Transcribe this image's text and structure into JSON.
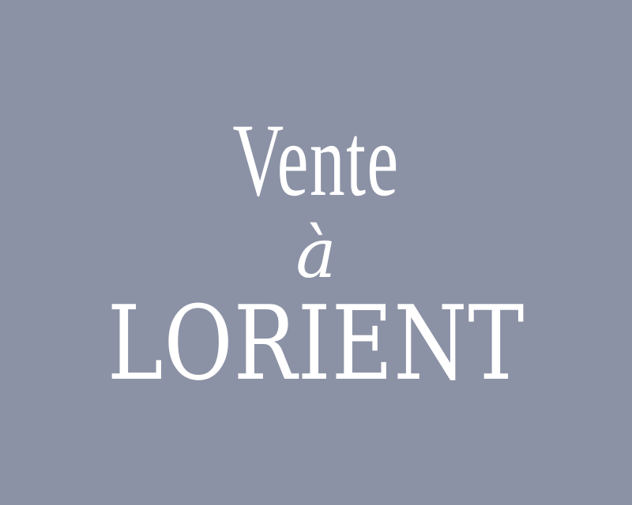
{
  "colors": {
    "background": "#8c92a5",
    "text": "#ffffff"
  },
  "title": {
    "line1": "Vente",
    "line2": "à",
    "line3": "LORIENT"
  }
}
